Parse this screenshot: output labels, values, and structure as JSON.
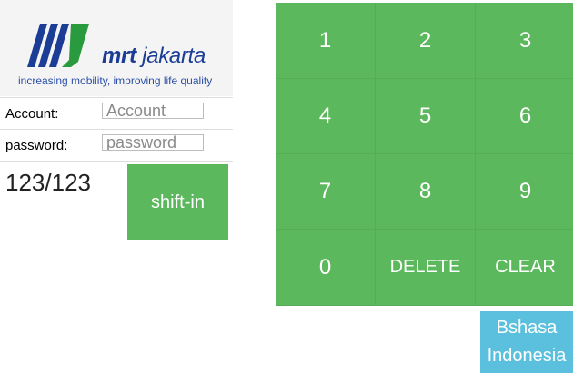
{
  "logo": {
    "brand_prefix": "mrt",
    "brand_name": "jakarta",
    "tagline": "increasing mobility, improving life quality",
    "colors": {
      "dark_blue": "#1b3d96",
      "light_blue": "#2a4fa8",
      "green": "#2a9a3e"
    }
  },
  "form": {
    "account_label": "Account:",
    "account_placeholder": "Account",
    "password_label": "password:",
    "password_placeholder": "password"
  },
  "counter": "123/123",
  "shift_button": "shift-in",
  "keypad": {
    "keys": [
      "1",
      "2",
      "3",
      "4",
      "5",
      "6",
      "7",
      "8",
      "9",
      "0",
      "DELETE",
      "CLEAR"
    ]
  },
  "language_button": {
    "line1": "Bshasa",
    "line2": "Indonesia"
  },
  "colors": {
    "keypad_green": "#5cb85c",
    "language_blue": "#5bc0de"
  }
}
